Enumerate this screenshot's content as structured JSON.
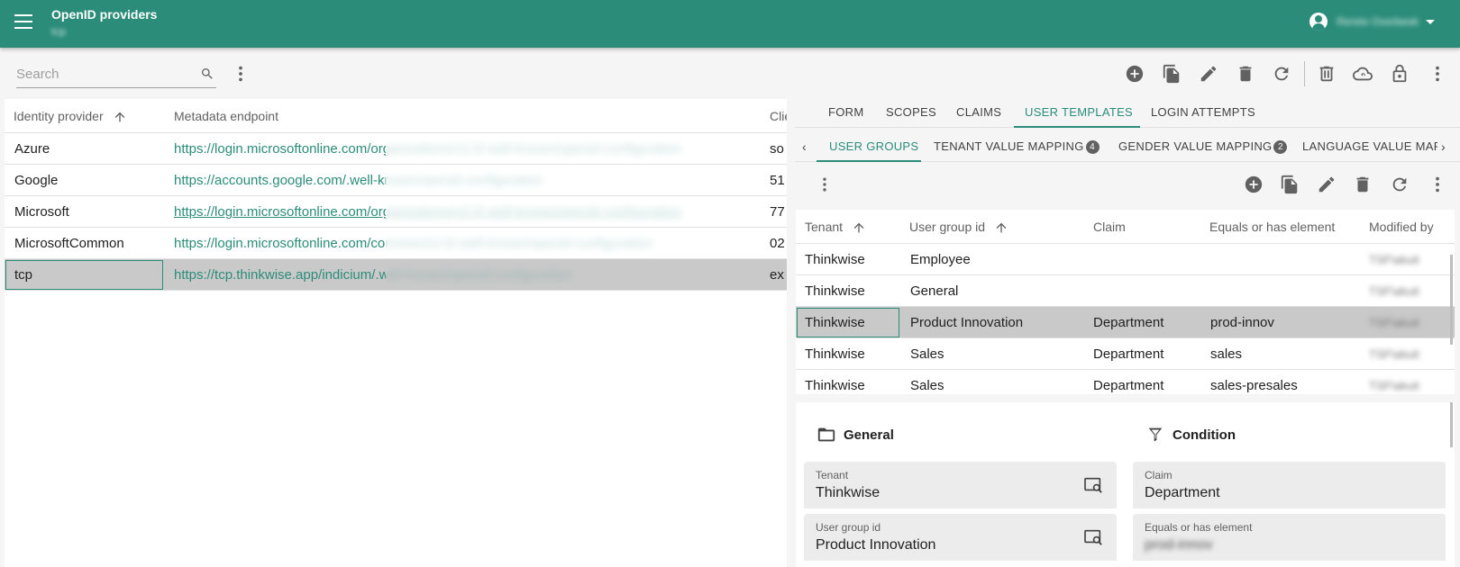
{
  "app": {
    "title": "OpenID providers",
    "subtitle": "tcp",
    "user_name": "Renée Overbeek"
  },
  "search": {
    "placeholder": "Search",
    "value": ""
  },
  "icons": {
    "menu": "menu-icon",
    "search": "search-icon",
    "more": "more-vert-icon",
    "add": "add-circle-icon",
    "copy": "copy-icon",
    "edit": "edit-icon",
    "delete": "delete-icon",
    "refresh": "refresh-icon",
    "trash": "trash-outline-icon",
    "cloud": "cloud-sync-icon",
    "lock": "lock-icon",
    "folder": "folder-icon",
    "filter": "filter-icon"
  },
  "left_grid": {
    "columns": [
      "Identity provider",
      "Metadata endpoint",
      "Clie"
    ],
    "rows": [
      {
        "provider": "Azure",
        "endpoint": "https://login.microsoftonline.com/organizations/v2.0/.well-known/openid-configuration",
        "client": "so"
      },
      {
        "provider": "Google",
        "endpoint": "https://accounts.google.com/.well-known/openid-configuration",
        "client": "51"
      },
      {
        "provider": "Microsoft",
        "endpoint": "https://login.microsoftonline.com/organizations/v2.0/.well-known/openid-configuration",
        "client": "77"
      },
      {
        "provider": "MicrosoftCommon",
        "endpoint": "https://login.microsoftonline.com/common/v2.0/.well-known/openid-configuration",
        "client": "02"
      },
      {
        "provider": "tcp",
        "endpoint": "https://tcp.thinkwise.app/indicium/.well-known/openid-configuration",
        "client": "ex"
      }
    ]
  },
  "tabs_main": [
    "FORM",
    "SCOPES",
    "CLAIMS",
    "USER TEMPLATES",
    "LOGIN ATTEMPTS"
  ],
  "tabs_sub": [
    {
      "label": "USER GROUPS",
      "badge": ""
    },
    {
      "label": "TENANT VALUE MAPPING",
      "badge": "4"
    },
    {
      "label": "GENDER VALUE MAPPING",
      "badge": "2"
    },
    {
      "label": "LANGUAGE VALUE MAP",
      "badge": ""
    }
  ],
  "right_grid": {
    "columns": [
      "Tenant",
      "User group id",
      "Claim",
      "Equals or has element",
      "Modified by"
    ],
    "rows": [
      {
        "tenant": "Thinkwise",
        "group": "Employee",
        "claim": "",
        "element": "",
        "modified": "TSF\\akuit"
      },
      {
        "tenant": "Thinkwise",
        "group": "General",
        "claim": "",
        "element": "",
        "modified": "TSF\\akuit"
      },
      {
        "tenant": "Thinkwise",
        "group": "Product Innovation",
        "claim": "Department",
        "element": "prod-innov",
        "modified": "TSF\\akuit"
      },
      {
        "tenant": "Thinkwise",
        "group": "Sales",
        "claim": "Department",
        "element": "sales",
        "modified": "TSF\\akuit"
      },
      {
        "tenant": "Thinkwise",
        "group": "Sales",
        "claim": "Department",
        "element": "sales-presales",
        "modified": "TSF\\akuit"
      }
    ]
  },
  "form": {
    "general_title": "General",
    "condition_title": "Condition",
    "tenant_label": "Tenant",
    "tenant_value": "Thinkwise",
    "group_label": "User group id",
    "group_value": "Product Innovation",
    "claim_label": "Claim",
    "claim_value": "Department",
    "element_label": "Equals or has element",
    "element_value": "prod-innov"
  }
}
